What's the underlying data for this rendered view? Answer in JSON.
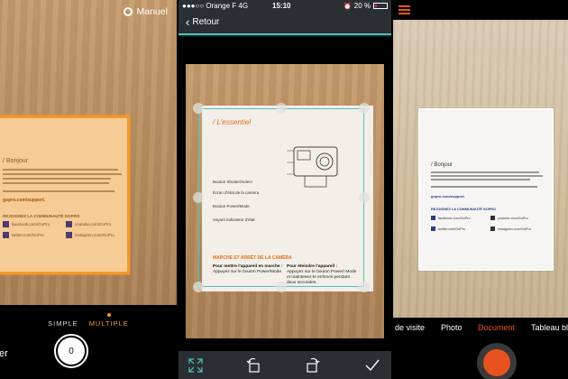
{
  "panel1": {
    "mode_label": "Manuel",
    "tab_simple": "SIMPLE",
    "tab_multiple": "MULTIPLE",
    "side_label": "er",
    "shutter_count": "0",
    "doc_heading": "/ Bonjour",
    "doc_link": "gopro.com/support.",
    "doc_community": "REJOIGNEZ LA COMMUNAUTÉ GOPRO",
    "doc_social": [
      "facebook.com/GoPro",
      "youtube.com/GoPro",
      "twitter.com/GoPro",
      "instagram.com/GoPro"
    ],
    "accent_color": "#f29a2c"
  },
  "panel2": {
    "status": {
      "carrier": "●●●○○ Orange F  4G",
      "time": "15:10",
      "battery": "20 %",
      "battery_level": 0.2
    },
    "back_label": "Retour",
    "doc_title": "/ L'essentiel",
    "labels": [
      "Bouton Shutter/Select",
      "Écran d'état de la caméra",
      "Bouton Power/Mode",
      "Voyant indicateur d'état"
    ],
    "section_title": "MARCHE ET ARRÊT DE LA CAMÉRA",
    "col1_title": "Pour mettre l'appareil en marche :",
    "col1_text": "Appuyez sur le bouton Power/Mode.",
    "col2_title": "Pour éteindre l'appareil :",
    "col2_text": "Appuyez sur le bouton Power/ Mode et maintenez-le enfoncé pendant deux secondes.",
    "toolbar_icons": [
      "expand-icon",
      "rotate-left-icon",
      "rotate-right-icon",
      "checkmark-icon"
    ],
    "accent_color": "#4fc2ba"
  },
  "panel3": {
    "modes": [
      "de visite",
      "Photo",
      "Document",
      "Tableau bl"
    ],
    "active_mode": "Document",
    "doc_heading": "/ Bonjour",
    "doc_link": "gopro.com/support.",
    "doc_community": "REJOIGNEZ LA COMMUNAUTÉ GOPRO",
    "doc_social": [
      "facebook.com/GoPro",
      "youtube.com/GoPro",
      "twitter.com/GoPro",
      "instagram.com/GoPro"
    ],
    "accent_color": "#e95420"
  }
}
